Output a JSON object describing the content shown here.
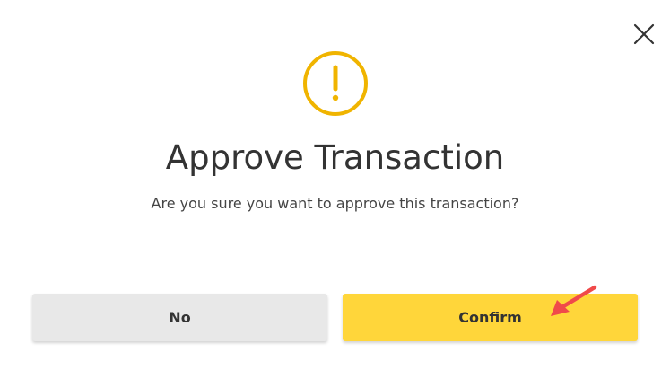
{
  "dialog": {
    "title": "Approve Transaction",
    "message": "Are you sure you want to approve this transaction?",
    "no_label": "No",
    "confirm_label": "Confirm",
    "icons": {
      "close": "close-icon",
      "warning": "exclamation-circle-icon",
      "annotation": "red-arrow-annotation"
    },
    "colors": {
      "warning": "#f0b400",
      "confirm_bg": "#ffd63a",
      "no_bg": "#e8e8e8",
      "arrow": "#f04a4a"
    }
  }
}
